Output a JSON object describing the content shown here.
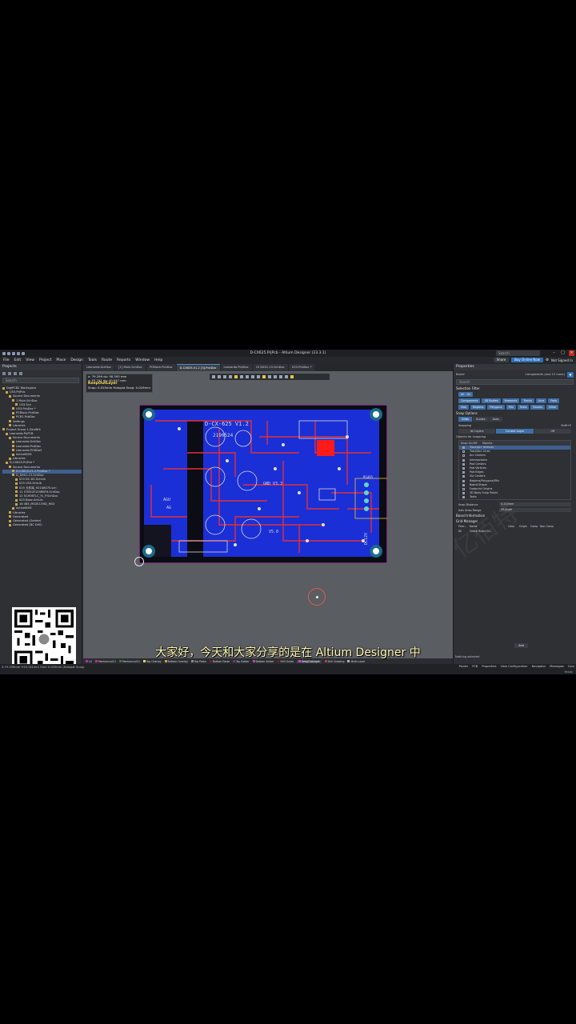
{
  "window": {
    "title": "D-CX625.PrjPcb - Altium Designer (23.3.1)",
    "search": "Search",
    "share": "Share",
    "buy": "Buy Online Now",
    "user": "Not Signed In"
  },
  "menu": [
    "File",
    "Edit",
    "View",
    "Project",
    "Place",
    "Design",
    "Tools",
    "Route",
    "Reports",
    "Window",
    "Help"
  ],
  "projects_panel": {
    "title": "Projects",
    "search_placeholder": "Search",
    "tree": [
      {
        "label": "DigiPCB2 Workspace",
        "indent": 0,
        "selected": false
      },
      {
        "label": "U53.PrjPcb",
        "indent": 1,
        "selected": false
      },
      {
        "label": "Source Documents",
        "indent": 2,
        "selected": false
      },
      {
        "label": "1 Main.SchDoc",
        "indent": 3,
        "selected": false
      },
      {
        "label": "U53.Sch",
        "indent": 4,
        "selected": false
      },
      {
        "label": "U53.PcbDoc *",
        "indent": 3,
        "selected": false
      },
      {
        "label": "PCBlock.PcbDoc",
        "indent": 3,
        "selected": false
      },
      {
        "label": "PCB1.PcbDoc",
        "indent": 3,
        "selected": false
      },
      {
        "label": "Settings",
        "indent": 2,
        "selected": false
      },
      {
        "label": "Libraries",
        "indent": 2,
        "selected": false
      },
      {
        "label": "Project Group 1.DsnWrk",
        "indent": 0,
        "selected": false
      },
      {
        "label": "Leonardo.PrjPCB",
        "indent": 1,
        "selected": false
      },
      {
        "label": "Source Documents",
        "indent": 2,
        "selected": false
      },
      {
        "label": "Leonardo.SchDoc",
        "indent": 3,
        "selected": false
      },
      {
        "label": "Leonardo.PcbDoc",
        "indent": 3,
        "selected": false
      },
      {
        "label": "Leonardo.PCBDwf",
        "indent": 3,
        "selected": false
      },
      {
        "label": "ActiveBOM",
        "indent": 3,
        "selected": false
      },
      {
        "label": "Libraries",
        "indent": 2,
        "selected": false
      },
      {
        "label": "D-CX625.PrjPcb *",
        "indent": 1,
        "selected": false
      },
      {
        "label": "Source Documents",
        "indent": 2,
        "selected": false
      },
      {
        "label": "D-CX625-V1.2.PcbDoc *",
        "indent": 3,
        "selected": true
      },
      {
        "label": "D_DX01-15.SchDoc",
        "indent": 3,
        "selected": false
      },
      {
        "label": "025 DC-DC.SchLib",
        "indent": 4,
        "selected": false
      },
      {
        "label": "025 U53.SchLib",
        "indent": 4,
        "selected": false
      },
      {
        "label": "025 元件库_H2108470.sch",
        "indent": 4,
        "selected": false
      },
      {
        "label": "11 STM32F103RBT6.SchDoc",
        "indent": 4,
        "selected": false
      },
      {
        "label": "12 SCH06TLC_YL_P.SchDoc",
        "indent": 4,
        "selected": false
      },
      {
        "label": "025 Base.SchLib",
        "indent": 4,
        "selected": false
      },
      {
        "label": "16 485_MS3011MD_M03",
        "indent": 4,
        "selected": false
      },
      {
        "label": "ActiveBOM",
        "indent": 3,
        "selected": false
      },
      {
        "label": "Libraries",
        "indent": 2,
        "selected": false
      },
      {
        "label": "Generated",
        "indent": 2,
        "selected": false
      },
      {
        "label": "Generated (Gerber)",
        "indent": 2,
        "selected": false
      },
      {
        "label": "Generated (NC Drill)",
        "indent": 2,
        "selected": false
      }
    ]
  },
  "doc_tabs": [
    {
      "label": "Leonardo.SchDoc",
      "active": false
    },
    {
      "label": "[1] Main.SchDoc",
      "active": false
    },
    {
      "label": "PCBlock.PcbDoc",
      "active": false
    },
    {
      "label": "D-CX625-V1.2 [3].PcbDoc",
      "active": true
    },
    {
      "label": "Leonardo.PcbDoc",
      "active": false
    },
    {
      "label": "10 DX01-15.SchDoc",
      "active": false
    },
    {
      "label": "U53.PcbDoc *",
      "active": false
    }
  ],
  "hud": {
    "line1": "x: 79.299   dx: 58.393  mm",
    "line2": "y: 53.741   dy: 40.047  mm",
    "layer": "KeepOutLayer",
    "line4": "Snap: 0.025mm Hotspot Snap: 0.025mm"
  },
  "pcb": {
    "silkscreen_title": "D-CX-625 V1.2",
    "date": "2190524",
    "labels": [
      "GND V3.3",
      "V5.0",
      "AGU",
      "AG",
      "RS485",
      "DC12V"
    ]
  },
  "properties": {
    "title": "Properties",
    "board_label": "Board",
    "board_value": "Components (and 12 more)",
    "search": "Search",
    "selection_filter_title": "Selection Filter",
    "all_on": "All - On",
    "filter_chips": [
      "Components",
      "3D Bodies",
      "Keepouts",
      "Tracks",
      "Arcs",
      "Pads",
      "Vias",
      "Regions",
      "Polygons",
      "Fills",
      "Texts",
      "Rooms",
      "Other"
    ],
    "snap_options_title": "Snap Options",
    "snap_modes": [
      {
        "label": "Grids",
        "on": true
      },
      {
        "label": "Guides",
        "on": false
      },
      {
        "label": "Axes",
        "on": false
      }
    ],
    "snapping_label": "Snapping",
    "snapping_shortcut": "Shift+E",
    "snapping_modes": [
      {
        "label": "All Layers",
        "on": false
      },
      {
        "label": "Current Layer",
        "on": true
      },
      {
        "label": "Off",
        "on": false
      }
    ],
    "objects_title": "Objects for snapping",
    "objects_header": [
      "Snap On/Off",
      "Objects"
    ],
    "objects": [
      {
        "label": "Track/Arc Vertices",
        "on": true,
        "selected": true
      },
      {
        "label": "Track/Arc Lines",
        "on": false,
        "selected": false
      },
      {
        "label": "Arc Centers",
        "on": false,
        "selected": false
      },
      {
        "label": "Intersections",
        "on": true,
        "selected": false
      },
      {
        "label": "Pad Centers",
        "on": true,
        "selected": false
      },
      {
        "label": "Pad Vertices",
        "on": true,
        "selected": false
      },
      {
        "label": "Pad Edges",
        "on": true,
        "selected": false
      },
      {
        "label": "Via Centers",
        "on": true,
        "selected": false
      },
      {
        "label": "Regions/Polygons/Fills",
        "on": true,
        "selected": false
      },
      {
        "label": "Board Shape",
        "on": true,
        "selected": false
      },
      {
        "label": "Footprint Origins",
        "on": false,
        "selected": false
      },
      {
        "label": "3D Body Snap Points",
        "on": true,
        "selected": false
      },
      {
        "label": "Texts",
        "on": true,
        "selected": false
      }
    ],
    "snap_distance_label": "Snap Distance",
    "snap_distance_value": "0.203mm",
    "axis_snap_label": "Axis Snap Range",
    "axis_snap_value": "25.4mm",
    "board_info_title": "Board Information",
    "grid_manager_title": "Grid Manager",
    "grid_header": [
      "Prior...",
      "Name",
      "Color",
      "Origin",
      "Comp",
      "Non Comp"
    ],
    "grid_rows": [
      {
        "priority": "80",
        "name": "Global Board Sn..."
      }
    ],
    "add_label": "Add",
    "nothing_selected": "Nothing selected"
  },
  "layers": [
    {
      "label": "LS",
      "color": "#c91fc9",
      "active": false
    },
    {
      "label": "Mechanical13",
      "color": "#c22d8e",
      "active": false
    },
    {
      "label": "Mechanical15",
      "color": "#3a7a3a",
      "active": false
    },
    {
      "label": "Top Overlay",
      "color": "#e5d34a",
      "active": false
    },
    {
      "label": "Bottom Overlay",
      "color": "#d7a23b",
      "active": false
    },
    {
      "label": "Top Paste",
      "color": "#8a8a8a",
      "active": false
    },
    {
      "label": "Bottom Paste",
      "color": "#7a1f1f",
      "active": false
    },
    {
      "label": "Top Solder",
      "color": "#7a2f7a",
      "active": false
    },
    {
      "label": "Bottom Solder",
      "color": "#b54aa3",
      "active": false
    },
    {
      "label": "Drill Guide",
      "color": "#7a1f1f",
      "active": false
    },
    {
      "label": "KeepOutLayer",
      "color": "#d93bd9",
      "active": true
    },
    {
      "label": "Drill Drawing",
      "color": "#cc3b3b",
      "active": false
    },
    {
      "label": "Multi-Layer",
      "color": "#b0b0b0",
      "active": false
    }
  ],
  "status": {
    "coords": "X:79.299mm Y:53.741mm   Grid: 0.025mm   (Hotspot Snap)",
    "panels": [
      "Panels",
      "PCB",
      "Properties",
      "View Configuration",
      "Navigator",
      "Messages",
      "Com"
    ],
    "ready": "Ready"
  },
  "subtitle": "大家好，今天和大家分享的是在 Altium Designer 中",
  "colors": {
    "pcb_copper_bottom": "#1b2fd6",
    "pcb_trace_top": "#e0303a",
    "pcb_silk": "#d8d8d8",
    "accent": "#2f6fb7"
  }
}
